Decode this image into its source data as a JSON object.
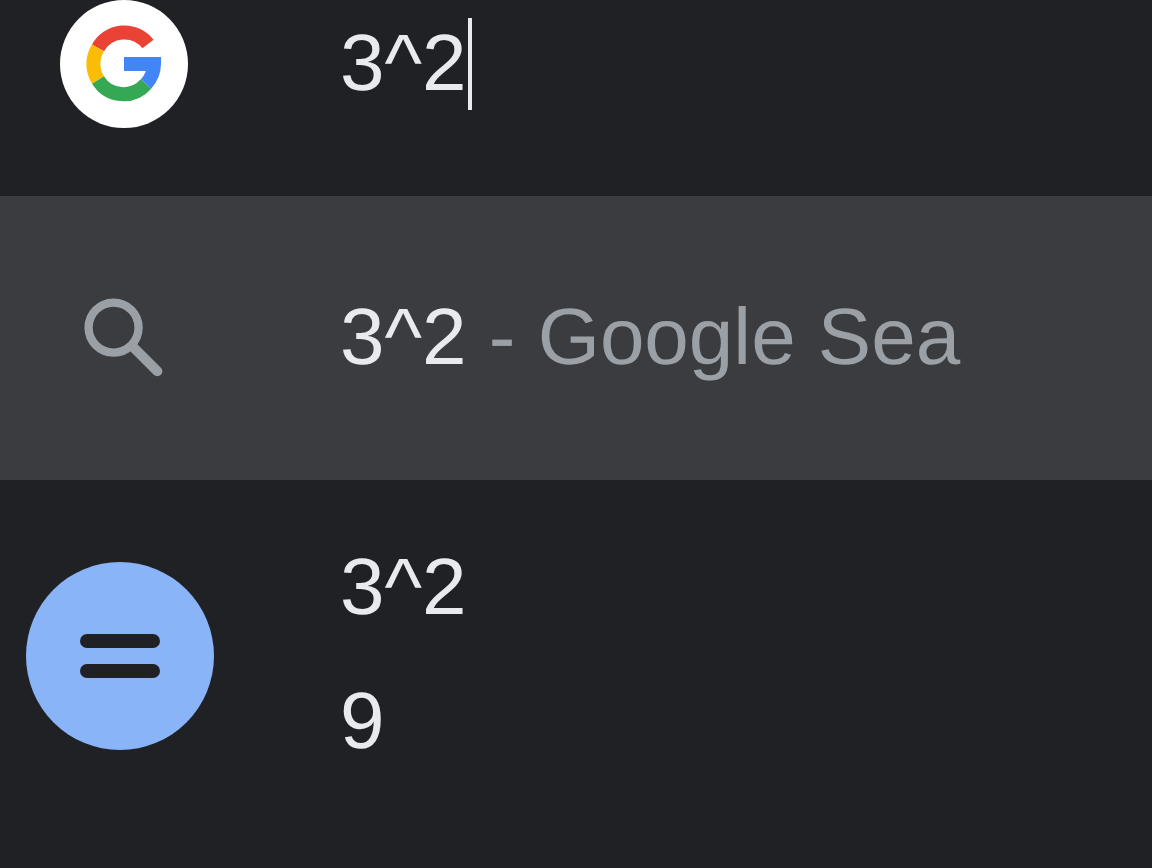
{
  "omnibox": {
    "value": "3^2"
  },
  "suggestions": [
    {
      "kind": "search",
      "query": "3^2",
      "suffix": "- Google Sea",
      "selected": true
    },
    {
      "kind": "answer",
      "query": "3^2",
      "answer": "9",
      "selected": false
    }
  ]
}
